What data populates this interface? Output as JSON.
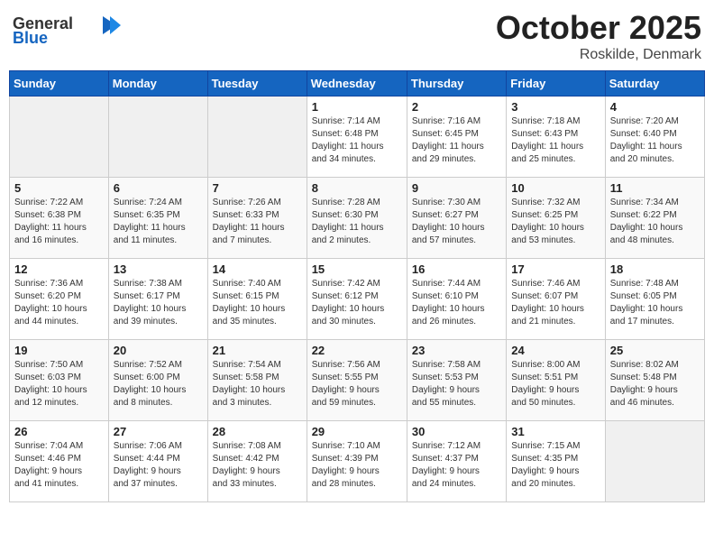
{
  "header": {
    "logo": {
      "general": "General",
      "blue": "Blue"
    },
    "title": "October 2025",
    "location": "Roskilde, Denmark"
  },
  "weekdays": [
    "Sunday",
    "Monday",
    "Tuesday",
    "Wednesday",
    "Thursday",
    "Friday",
    "Saturday"
  ],
  "weeks": [
    [
      {
        "day": "",
        "info": ""
      },
      {
        "day": "",
        "info": ""
      },
      {
        "day": "",
        "info": ""
      },
      {
        "day": "1",
        "info": "Sunrise: 7:14 AM\nSunset: 6:48 PM\nDaylight: 11 hours\nand 34 minutes."
      },
      {
        "day": "2",
        "info": "Sunrise: 7:16 AM\nSunset: 6:45 PM\nDaylight: 11 hours\nand 29 minutes."
      },
      {
        "day": "3",
        "info": "Sunrise: 7:18 AM\nSunset: 6:43 PM\nDaylight: 11 hours\nand 25 minutes."
      },
      {
        "day": "4",
        "info": "Sunrise: 7:20 AM\nSunset: 6:40 PM\nDaylight: 11 hours\nand 20 minutes."
      }
    ],
    [
      {
        "day": "5",
        "info": "Sunrise: 7:22 AM\nSunset: 6:38 PM\nDaylight: 11 hours\nand 16 minutes."
      },
      {
        "day": "6",
        "info": "Sunrise: 7:24 AM\nSunset: 6:35 PM\nDaylight: 11 hours\nand 11 minutes."
      },
      {
        "day": "7",
        "info": "Sunrise: 7:26 AM\nSunset: 6:33 PM\nDaylight: 11 hours\nand 7 minutes."
      },
      {
        "day": "8",
        "info": "Sunrise: 7:28 AM\nSunset: 6:30 PM\nDaylight: 11 hours\nand 2 minutes."
      },
      {
        "day": "9",
        "info": "Sunrise: 7:30 AM\nSunset: 6:27 PM\nDaylight: 10 hours\nand 57 minutes."
      },
      {
        "day": "10",
        "info": "Sunrise: 7:32 AM\nSunset: 6:25 PM\nDaylight: 10 hours\nand 53 minutes."
      },
      {
        "day": "11",
        "info": "Sunrise: 7:34 AM\nSunset: 6:22 PM\nDaylight: 10 hours\nand 48 minutes."
      }
    ],
    [
      {
        "day": "12",
        "info": "Sunrise: 7:36 AM\nSunset: 6:20 PM\nDaylight: 10 hours\nand 44 minutes."
      },
      {
        "day": "13",
        "info": "Sunrise: 7:38 AM\nSunset: 6:17 PM\nDaylight: 10 hours\nand 39 minutes."
      },
      {
        "day": "14",
        "info": "Sunrise: 7:40 AM\nSunset: 6:15 PM\nDaylight: 10 hours\nand 35 minutes."
      },
      {
        "day": "15",
        "info": "Sunrise: 7:42 AM\nSunset: 6:12 PM\nDaylight: 10 hours\nand 30 minutes."
      },
      {
        "day": "16",
        "info": "Sunrise: 7:44 AM\nSunset: 6:10 PM\nDaylight: 10 hours\nand 26 minutes."
      },
      {
        "day": "17",
        "info": "Sunrise: 7:46 AM\nSunset: 6:07 PM\nDaylight: 10 hours\nand 21 minutes."
      },
      {
        "day": "18",
        "info": "Sunrise: 7:48 AM\nSunset: 6:05 PM\nDaylight: 10 hours\nand 17 minutes."
      }
    ],
    [
      {
        "day": "19",
        "info": "Sunrise: 7:50 AM\nSunset: 6:03 PM\nDaylight: 10 hours\nand 12 minutes."
      },
      {
        "day": "20",
        "info": "Sunrise: 7:52 AM\nSunset: 6:00 PM\nDaylight: 10 hours\nand 8 minutes."
      },
      {
        "day": "21",
        "info": "Sunrise: 7:54 AM\nSunset: 5:58 PM\nDaylight: 10 hours\nand 3 minutes."
      },
      {
        "day": "22",
        "info": "Sunrise: 7:56 AM\nSunset: 5:55 PM\nDaylight: 9 hours\nand 59 minutes."
      },
      {
        "day": "23",
        "info": "Sunrise: 7:58 AM\nSunset: 5:53 PM\nDaylight: 9 hours\nand 55 minutes."
      },
      {
        "day": "24",
        "info": "Sunrise: 8:00 AM\nSunset: 5:51 PM\nDaylight: 9 hours\nand 50 minutes."
      },
      {
        "day": "25",
        "info": "Sunrise: 8:02 AM\nSunset: 5:48 PM\nDaylight: 9 hours\nand 46 minutes."
      }
    ],
    [
      {
        "day": "26",
        "info": "Sunrise: 7:04 AM\nSunset: 4:46 PM\nDaylight: 9 hours\nand 41 minutes."
      },
      {
        "day": "27",
        "info": "Sunrise: 7:06 AM\nSunset: 4:44 PM\nDaylight: 9 hours\nand 37 minutes."
      },
      {
        "day": "28",
        "info": "Sunrise: 7:08 AM\nSunset: 4:42 PM\nDaylight: 9 hours\nand 33 minutes."
      },
      {
        "day": "29",
        "info": "Sunrise: 7:10 AM\nSunset: 4:39 PM\nDaylight: 9 hours\nand 28 minutes."
      },
      {
        "day": "30",
        "info": "Sunrise: 7:12 AM\nSunset: 4:37 PM\nDaylight: 9 hours\nand 24 minutes."
      },
      {
        "day": "31",
        "info": "Sunrise: 7:15 AM\nSunset: 4:35 PM\nDaylight: 9 hours\nand 20 minutes."
      },
      {
        "day": "",
        "info": ""
      }
    ]
  ]
}
